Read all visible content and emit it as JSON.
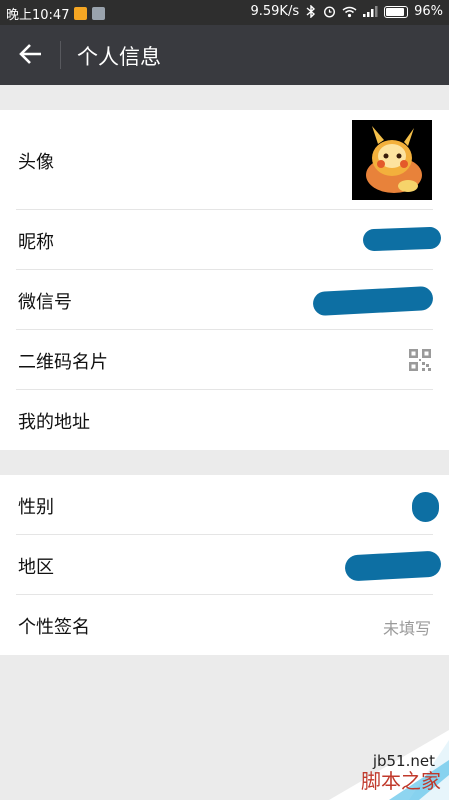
{
  "status_bar": {
    "time": "晚上10:47",
    "speed": "9.59K/s",
    "battery": "96%"
  },
  "header": {
    "title": "个人信息"
  },
  "profile": {
    "avatar_label": "头像",
    "nickname_label": "昵称",
    "wechat_id_label": "微信号",
    "qr_card_label": "二维码名片",
    "address_label": "我的地址"
  },
  "details": {
    "gender_label": "性别",
    "region_label": "地区",
    "signature_label": "个性签名",
    "signature_value": "未填写"
  },
  "watermark": {
    "site": "jb51.net",
    "name": "脚本之家"
  },
  "colors": {
    "titlebar": "#393a3f",
    "redaction_blue": "#0d6fa3",
    "background": "#ebebeb"
  }
}
